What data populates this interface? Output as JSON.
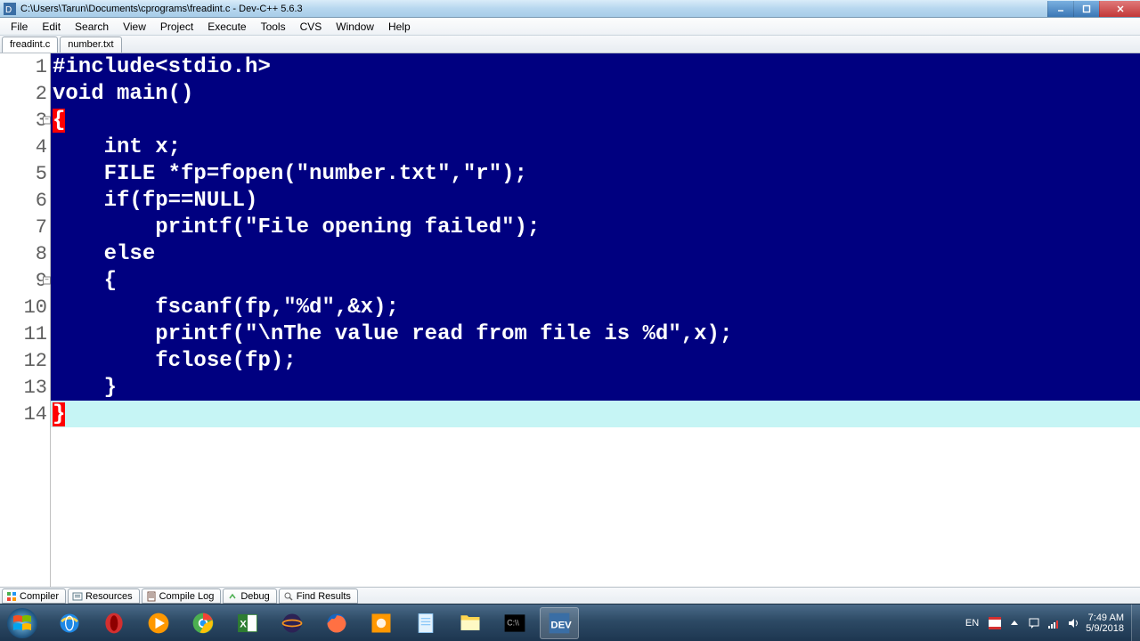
{
  "title": "C:\\Users\\Tarun\\Documents\\cprograms\\freadint.c - Dev-C++ 5.6.3",
  "menu": [
    "File",
    "Edit",
    "Search",
    "View",
    "Project",
    "Execute",
    "Tools",
    "CVS",
    "Window",
    "Help"
  ],
  "file_tabs": [
    {
      "label": "freadint.c",
      "active": true
    },
    {
      "label": "number.txt",
      "active": false
    }
  ],
  "code": {
    "current_line": 14,
    "fold_lines": [
      3,
      9
    ],
    "lines": [
      {
        "n": 1,
        "segments": [
          {
            "t": "#include",
            "c": "tok-kw"
          },
          {
            "t": "<stdio.h>"
          }
        ]
      },
      {
        "n": 2,
        "segments": [
          {
            "t": "void",
            "c": "tok-kw"
          },
          {
            "t": " main()"
          }
        ]
      },
      {
        "n": 3,
        "segments": [
          {
            "t": "{",
            "c": "brace-hl"
          }
        ]
      },
      {
        "n": 4,
        "segments": [
          {
            "t": "    "
          },
          {
            "t": "int",
            "c": "tok-kw"
          },
          {
            "t": " x;"
          }
        ]
      },
      {
        "n": 5,
        "segments": [
          {
            "t": "    FILE *fp=fopen("
          },
          {
            "t": "\"number.txt\"",
            "c": "tok-str"
          },
          {
            "t": ","
          },
          {
            "t": "\"r\"",
            "c": "tok-str"
          },
          {
            "t": ");"
          }
        ]
      },
      {
        "n": 6,
        "segments": [
          {
            "t": "    "
          },
          {
            "t": "if",
            "c": "tok-kw"
          },
          {
            "t": "(fp==NULL)"
          }
        ]
      },
      {
        "n": 7,
        "segments": [
          {
            "t": "        printf("
          },
          {
            "t": "\"File opening failed\"",
            "c": "tok-str"
          },
          {
            "t": ");"
          }
        ]
      },
      {
        "n": 8,
        "segments": [
          {
            "t": "    "
          },
          {
            "t": "else",
            "c": "tok-kw"
          }
        ]
      },
      {
        "n": 9,
        "segments": [
          {
            "t": "    {"
          }
        ]
      },
      {
        "n": 10,
        "segments": [
          {
            "t": "        fscanf(fp,"
          },
          {
            "t": "\"%d\"",
            "c": "tok-str"
          },
          {
            "t": ",&x);"
          }
        ]
      },
      {
        "n": 11,
        "segments": [
          {
            "t": "        printf("
          },
          {
            "t": "\"\\nThe value read from file is %d\"",
            "c": "tok-str"
          },
          {
            "t": ",x);"
          }
        ]
      },
      {
        "n": 12,
        "segments": [
          {
            "t": "        fclose(fp);"
          }
        ]
      },
      {
        "n": 13,
        "segments": [
          {
            "t": "    }"
          }
        ]
      },
      {
        "n": 14,
        "segments": [
          {
            "t": "}",
            "c": "brace-hl"
          }
        ],
        "current": true
      }
    ]
  },
  "bottom_tabs": [
    "Compiler",
    "Resources",
    "Compile Log",
    "Debug",
    "Find Results"
  ],
  "taskbar": {
    "lang": "EN",
    "time": "7:49 AM",
    "date": "5/9/2018"
  }
}
